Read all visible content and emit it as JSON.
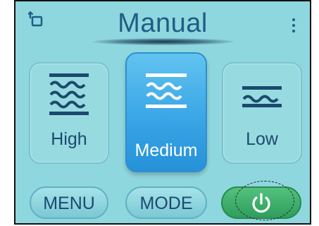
{
  "header": {
    "title": "Manual",
    "back_icon": "window-back-icon",
    "more_icon": "more-vertical-icon"
  },
  "levels": [
    {
      "label": "High",
      "icon": "heat-waves-high-icon",
      "selected": false
    },
    {
      "label": "Medium",
      "icon": "heat-waves-medium-icon",
      "selected": true
    },
    {
      "label": "Low",
      "icon": "heat-waves-low-icon",
      "selected": false
    }
  ],
  "buttons": {
    "menu_label": "MENU",
    "mode_label": "MODE",
    "power_icon": "power-icon"
  },
  "colors": {
    "screen_bg": "#8fd7de",
    "accent_blue": "#3aa6e6",
    "text_dark": "#1b4a6d",
    "power_green": "#2f9d5c"
  }
}
